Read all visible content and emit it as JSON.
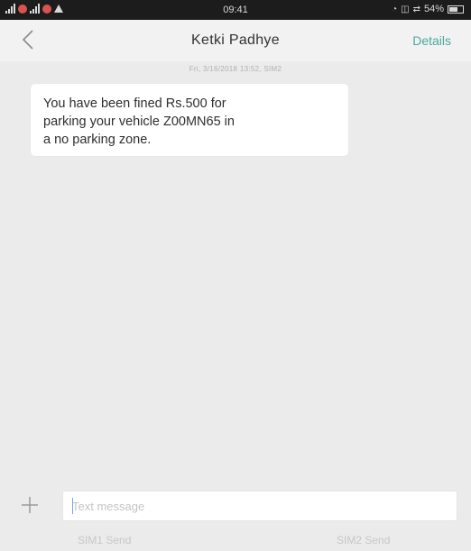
{
  "status_bar": {
    "time": "09:41",
    "battery": "54%"
  },
  "header": {
    "contact_name": "Ketki Padhye",
    "details_label": "Details"
  },
  "conversation": {
    "timestamp": "Fri, 3/16/2018 13:52, SIM2",
    "messages": [
      {
        "lines": [
          "You have been fined Rs.500 for",
          "parking your vehicle Z00MN65 in",
          "a no parking zone."
        ]
      }
    ]
  },
  "composer": {
    "placeholder": "Text message",
    "sim1_label": "SIM1 Send",
    "sim2_label": "SIM2 Send"
  },
  "colors": {
    "accent": "#4aa8a0",
    "background": "#ebebeb",
    "bubble": "#ffffff"
  }
}
